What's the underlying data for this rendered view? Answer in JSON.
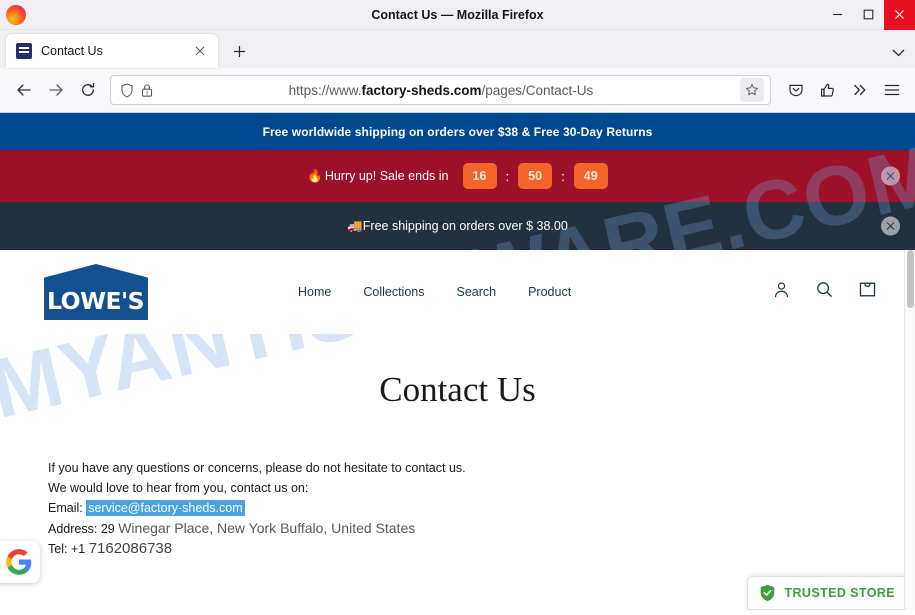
{
  "window": {
    "title": "Contact Us — Mozilla Firefox",
    "minimize_label": "Minimize",
    "maximize_label": "Maximize",
    "close_label": "Close"
  },
  "tabbar": {
    "tab_title": "Contact Us",
    "tab_close_label": "Close tab",
    "new_tab_label": "New tab",
    "list_all_tabs_label": "List all tabs"
  },
  "toolbar": {
    "back_label": "Back",
    "forward_label": "Forward",
    "reload_label": "Reload",
    "url_prefix": "https://www.",
    "url_domain": "factory-sheds.com",
    "url_path": "/pages/Contact-Us",
    "url_full": "https://www.factory-sheds.com/pages/Contact-Us",
    "bookmark_label": "Bookmark this page",
    "pocket_label": "Save to Pocket",
    "extensions_label": "Extensions",
    "overflow_label": "More tools",
    "menu_label": "Open application menu"
  },
  "page": {
    "watermark": "MYANTISPYWARE.COM",
    "promo_banner_1": "Free worldwide shipping on orders over $38 & Free 30-Day Returns",
    "promo_banner_2": {
      "emoji": "🔥",
      "text": "Hurry up! Sale ends in",
      "hours": "16",
      "minutes": "50",
      "seconds": "49",
      "separator": ":",
      "close_label": "Close"
    },
    "promo_banner_3": {
      "emoji": "🚚",
      "text": "Free shipping on orders over $ 38.00",
      "close_label": "Close"
    },
    "header": {
      "logo_text": "LOWE'S",
      "nav": [
        {
          "label": "Home"
        },
        {
          "label": "Collections"
        },
        {
          "label": "Search"
        },
        {
          "label": "Product"
        }
      ],
      "account_label": "Account",
      "search_label": "Search",
      "cart_label": "Cart"
    },
    "title": "Contact Us",
    "body": {
      "line1": "If you have any questions or concerns, please do not hesitate to contact us.",
      "line2": "We would love to hear from you, contact us on:",
      "email_label": "Email:",
      "email_value": "service@factory-sheds.com",
      "address_label": "Address:",
      "address_number": "29",
      "address_value": "Winegar Place, New York Buffalo, United States",
      "tel_label": "Tel:",
      "tel_code": "+1",
      "tel_value": "7162086738"
    },
    "trusted_badge": "TRUSTED STORE",
    "google_widget_label": "Google"
  },
  "colors": {
    "promo1_bg": "#004990",
    "promo2_bg": "#9d1029",
    "promo3_bg": "#23303d",
    "countdown_bg": "#f4642a",
    "brand_blue": "#12508f",
    "trusted_green": "#3a9e3a",
    "email_highlight": "#4aa3e0"
  }
}
